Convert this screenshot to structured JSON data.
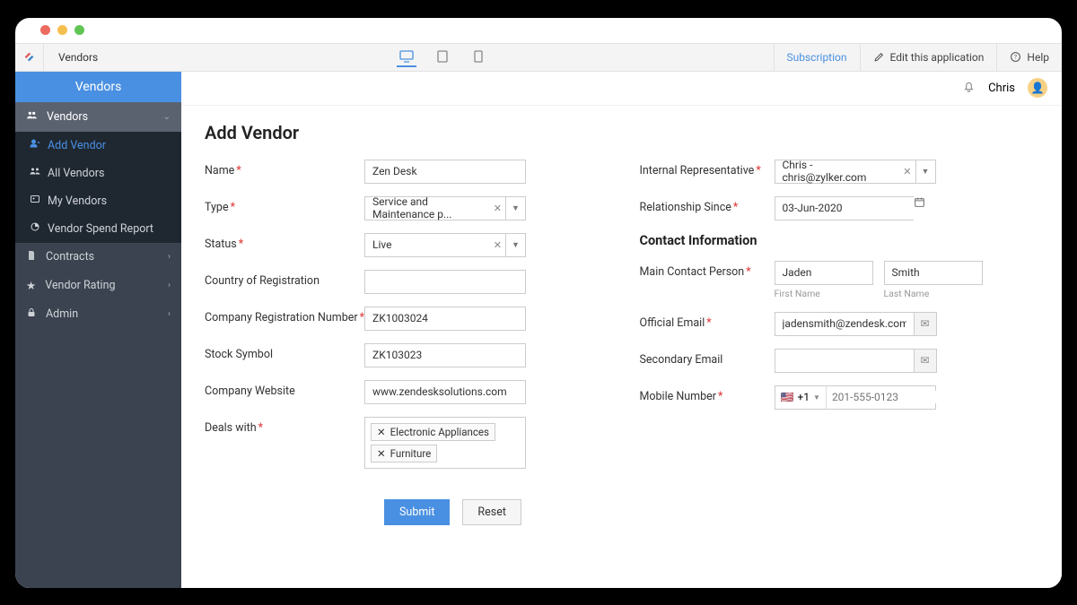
{
  "topbar": {
    "breadcrumb": "Vendors",
    "subscription": "Subscription",
    "edit_app": "Edit this application",
    "help": "Help"
  },
  "user": {
    "name": "Chris"
  },
  "sidebar": {
    "title": "Vendors",
    "vendors": "Vendors",
    "add_vendor": "Add Vendor",
    "all_vendors": "All Vendors",
    "my_vendors": "My Vendors",
    "spend_report": "Vendor Spend Report",
    "contracts": "Contracts",
    "rating": "Vendor Rating",
    "admin": "Admin"
  },
  "page": {
    "title": "Add Vendor"
  },
  "labels": {
    "name": "Name",
    "type": "Type",
    "status": "Status",
    "country": "Country of Registration",
    "reg_no": "Company Registration Number",
    "stock": "Stock Symbol",
    "website": "Company Website",
    "deals": "Deals with",
    "internal_rep": "Internal Representative",
    "rel_since": "Relationship Since",
    "contact_section": "Contact Information",
    "main_contact": "Main Contact Person",
    "first_name_hint": "First Name",
    "last_name_hint": "Last Name",
    "official_email": "Official Email",
    "secondary_email": "Secondary Email",
    "mobile": "Mobile Number"
  },
  "values": {
    "name": "Zen Desk",
    "type": "Service and Maintenance p...",
    "status": "Live",
    "country": "",
    "reg_no": "ZK1003024",
    "stock": "ZK103023",
    "website": "www.zendesksolutions.com",
    "deals_tag1": "Electronic Appliances",
    "deals_tag2": "Furniture",
    "internal_rep": "Chris - chris@zylker.com",
    "rel_since": "03-Jun-2020",
    "first_name": "Jaden",
    "last_name": "Smith",
    "official_email": "jadensmith@zendesk.com",
    "secondary_email": "",
    "phone_prefix": "+1",
    "phone_placeholder": "201-555-0123"
  },
  "buttons": {
    "submit": "Submit",
    "reset": "Reset"
  }
}
